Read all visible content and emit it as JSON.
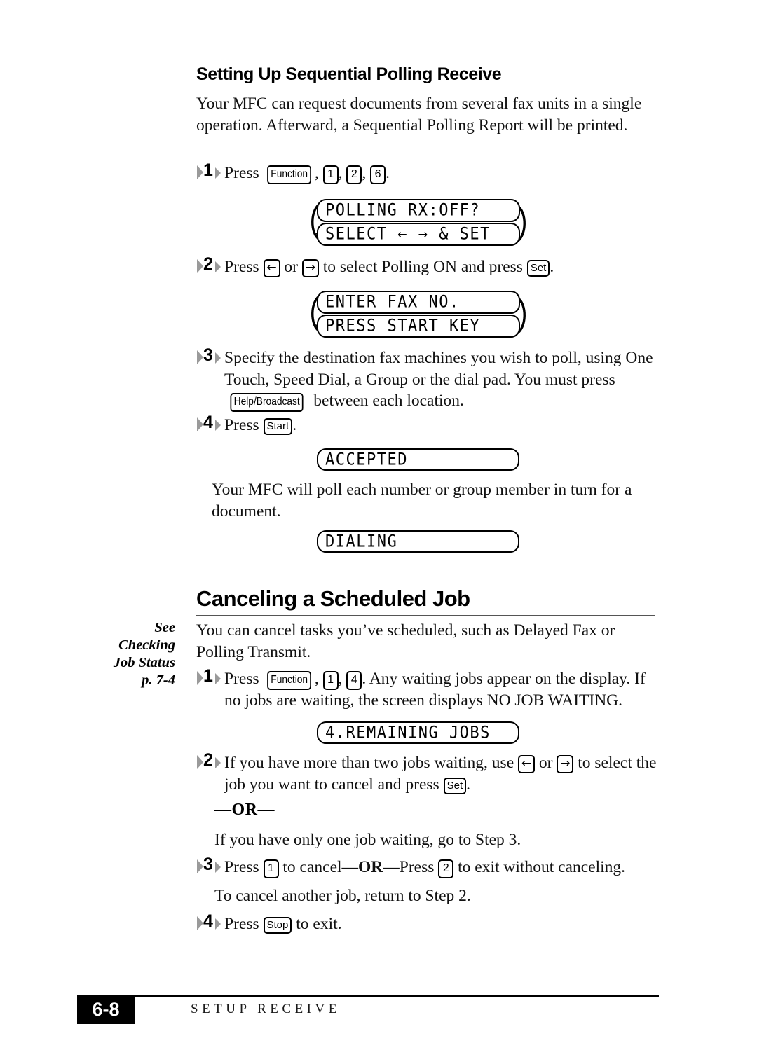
{
  "section1": {
    "heading": "Setting Up Sequential Polling Receive",
    "intro": "Your MFC can request documents from several fax units in a single operation. Afterward, a Sequential Polling Report will be printed.",
    "steps": {
      "s1_num": "1",
      "s1_press": "Press",
      "s1_key_function": "Function",
      "s1_key_1": "1",
      "s1_key_2": "2",
      "s1_key_6": "6",
      "s2_num": "2",
      "s2_a": "Press",
      "s2_key_left": "←",
      "s2_or": "or",
      "s2_key_right": "→",
      "s2_b": "to select Polling ON and press",
      "s2_key_set": "Set",
      "s3_num": "3",
      "s3_a": "Specify the destination fax machines you wish to poll, using One Touch, Speed Dial, a Group or the dial pad. You must press",
      "s3_key_help": "Help/Broadcast",
      "s3_b": "between each location.",
      "s4_num": "4",
      "s4_a": "Press",
      "s4_key_start": "Start",
      "s4_period": "."
    },
    "lcd1_line1": "POLLING RX:OFF?",
    "lcd1_line2": "SELECT ← → & SET",
    "lcd2_line1": "ENTER FAX NO.",
    "lcd2_line2": "PRESS START KEY",
    "lcd3": "ACCEPTED",
    "lcd4": "DIALING",
    "after_accepted": "Your MFC will poll each number or group member in turn for a document."
  },
  "section2": {
    "heading": "Canceling a Scheduled Job",
    "sidenote_lines": [
      "See",
      "Checking",
      "Job Status",
      "p. 7-4"
    ],
    "intro": "You can cancel tasks you’ve scheduled, such as Delayed Fax or Polling Transmit.",
    "steps": {
      "s1_num": "1",
      "s1_a": "Press",
      "s1_key_function": "Function",
      "s1_key_1": "1",
      "s1_key_4": "4",
      "s1_b": ". Any waiting jobs appear on the display. If no jobs are waiting, the screen displays NO JOB WAITING.",
      "s2_num": "2",
      "s2_a": "If you have more than two jobs waiting, use",
      "s2_key_left": "←",
      "s2_or": "or",
      "s2_key_right": "→",
      "s2_b": "to select the job you want to cancel and press",
      "s2_key_set": "Set",
      "s3_num": "3",
      "s3_a": "Press",
      "s3_key_1": "1",
      "s3_b": "to cancel",
      "s3_or": "—OR—",
      "s3_c": "Press",
      "s3_key_2": "2",
      "s3_d": "to exit without canceling.",
      "s4_num": "4",
      "s4_a": "Press",
      "s4_key_stop": "Stop",
      "s4_b": "to exit."
    },
    "or_divider": "—OR—",
    "one_job_line": "If you have only one job waiting, go to Step 3.",
    "another_job_line": "To cancel another job, return to Step 2.",
    "lcd_remaining": "4.REMAINING JOBS"
  },
  "footer": {
    "page_number": "6-8",
    "chapter_label": "SETUP RECEIVE"
  }
}
